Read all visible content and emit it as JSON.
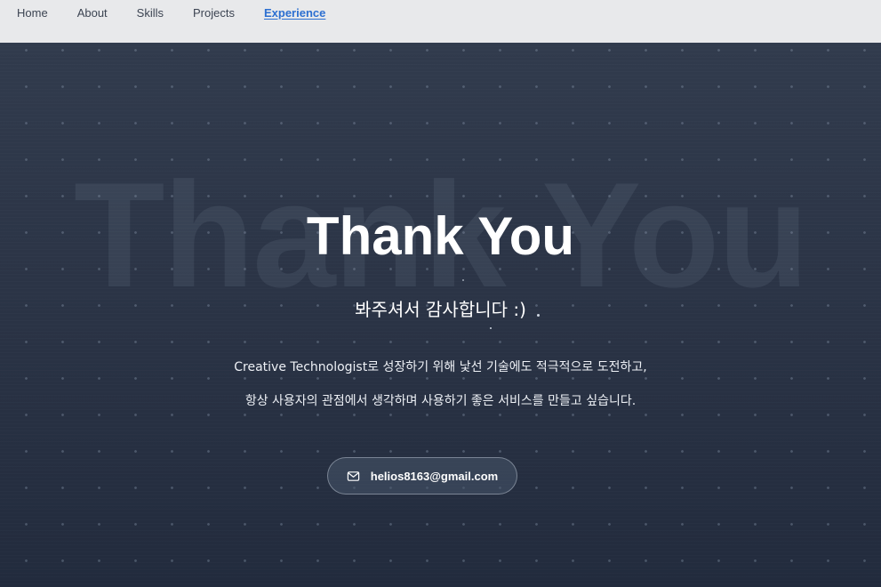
{
  "nav": {
    "items": [
      {
        "label": "Home",
        "active": false
      },
      {
        "label": "About",
        "active": false
      },
      {
        "label": "Skills",
        "active": false
      },
      {
        "label": "Projects",
        "active": false
      },
      {
        "label": "Experience",
        "active": true
      }
    ]
  },
  "hero": {
    "background_text": "Thank You",
    "title": "Thank You",
    "subtitle": "봐주셔서 감사합니다 :)",
    "description_line1": "Creative Technologist로 성장하기 위해 낯선 기술에도 적극적으로 도전하고,",
    "description_line2": "항상 사용자의 관점에서 생각하며 사용하기 좋은 서비스를 만들고 싶습니다.",
    "email_icon": "mail-icon",
    "email": "helios8163@gmail.com"
  },
  "colors": {
    "nav_bg": "#e8e9eb",
    "nav_active": "#2c6fd1",
    "hero_bg_top": "#313b4d",
    "hero_bg_bottom": "#222b3d",
    "text": "#ffffff"
  }
}
